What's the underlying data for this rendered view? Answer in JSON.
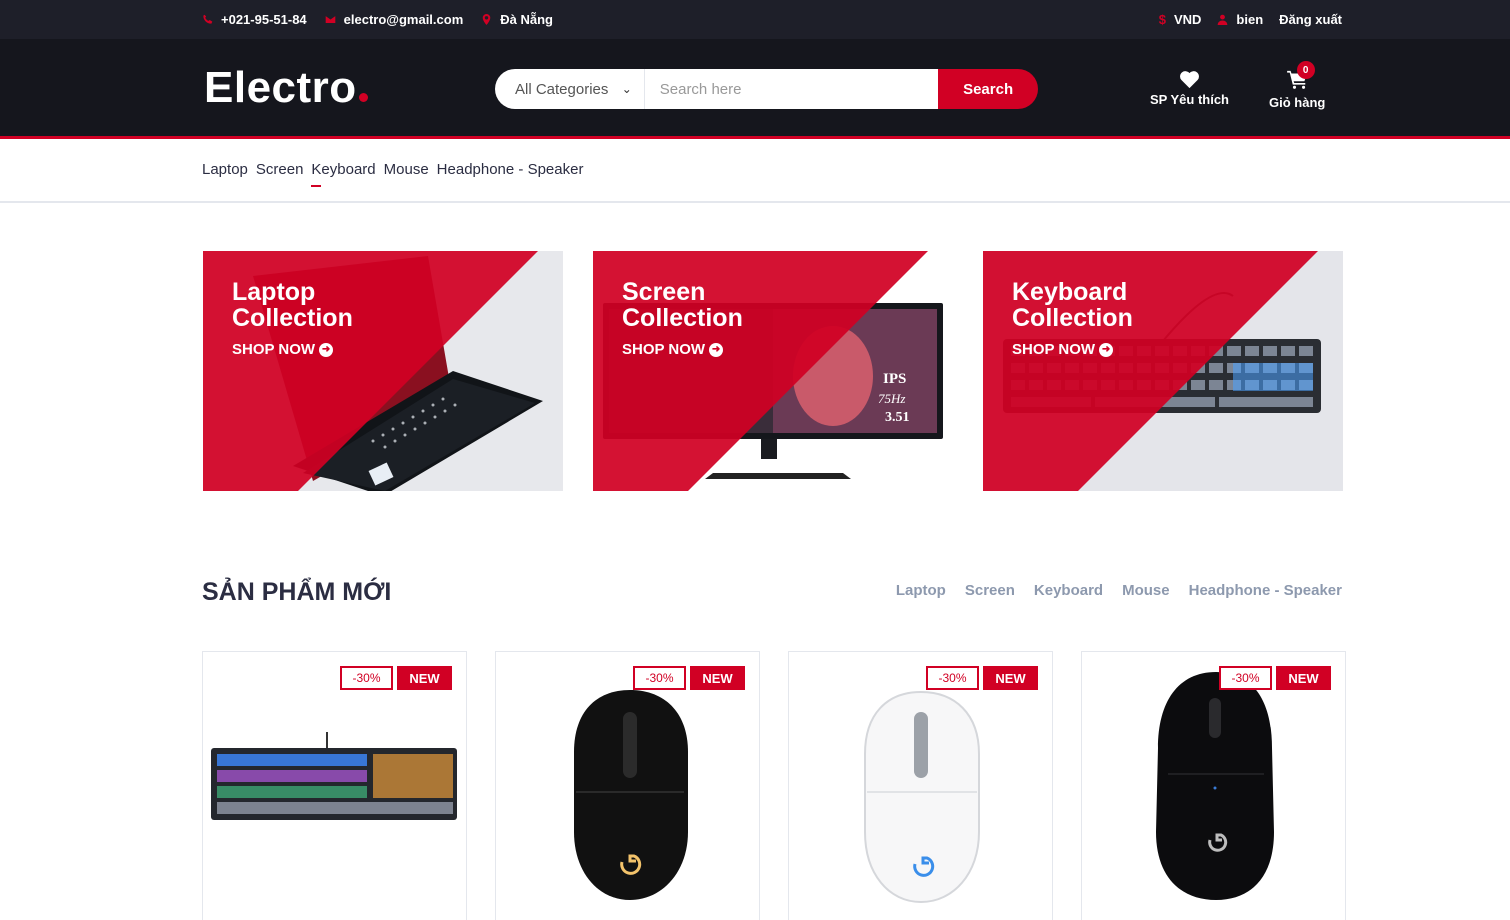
{
  "topbar": {
    "phone": "+021-95-51-84",
    "email": "electro@gmail.com",
    "location": "Đà Nẵng",
    "currency": "VND",
    "user": "bien",
    "logout": "Đăng xuất"
  },
  "header": {
    "logo": "Electro",
    "category_select": "All Categories",
    "search_placeholder": "Search here",
    "search_button": "Search",
    "wishlist_label": "SP Yêu thích",
    "cart_label": "Giỏ hàng",
    "cart_count": "0"
  },
  "nav": {
    "items": [
      "Laptop",
      "Screen",
      "Keyboard",
      "Mouse",
      "Headphone - Speaker"
    ],
    "active_index": 2
  },
  "collections": [
    {
      "title_line1": "Laptop",
      "title_line2": "Collection",
      "cta": "SHOP NOW"
    },
    {
      "title_line1": "Screen",
      "title_line2": "Collection",
      "cta": "SHOP NOW"
    },
    {
      "title_line1": "Keyboard",
      "title_line2": "Collection",
      "cta": "SHOP NOW"
    }
  ],
  "new_products": {
    "title": "SẢN PHẨM MỚI",
    "tabs": [
      "Laptop",
      "Screen",
      "Keyboard",
      "Mouse",
      "Headphone - Speaker"
    ],
    "items": [
      {
        "sale": "-30%",
        "badge": "NEW"
      },
      {
        "sale": "-30%",
        "badge": "NEW"
      },
      {
        "sale": "-30%",
        "badge": "NEW"
      },
      {
        "sale": "-30%",
        "badge": "NEW"
      }
    ]
  },
  "colors": {
    "accent": "#D10024",
    "dark": "#15161D",
    "topbar": "#1E1F29"
  }
}
